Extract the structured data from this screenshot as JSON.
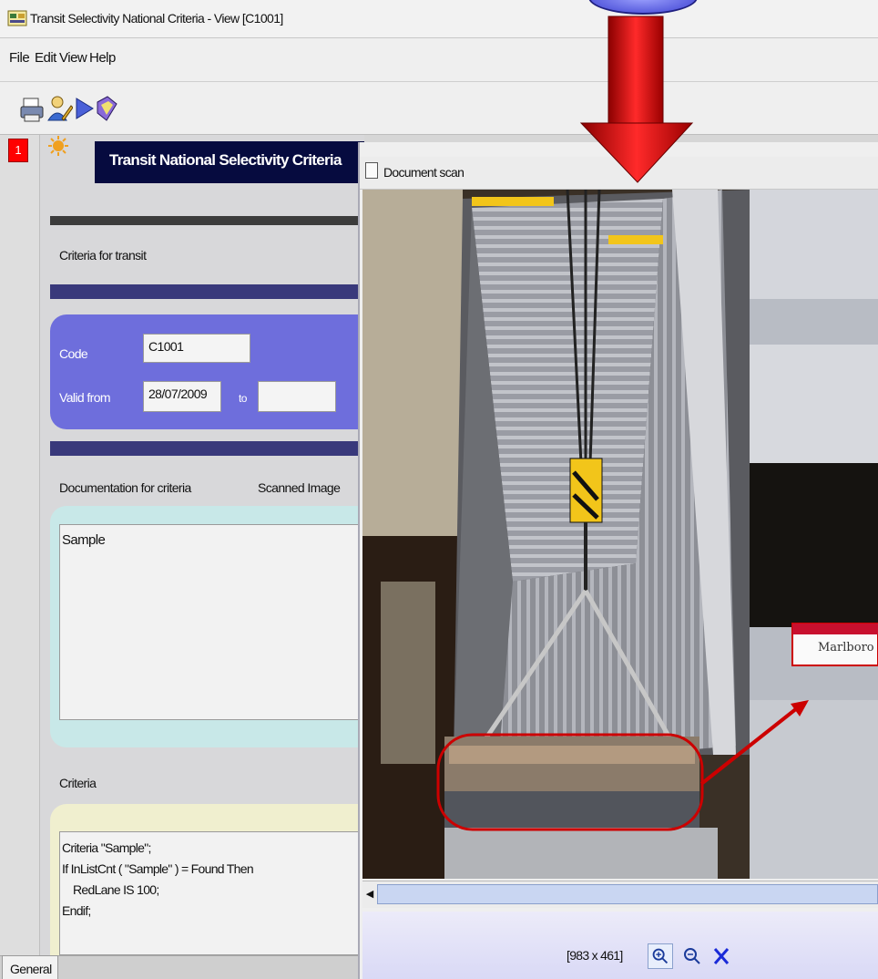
{
  "window": {
    "title": "Transit Selectivity National Criteria - View [C1001]"
  },
  "menu": [
    "File",
    "Edit",
    "View",
    "Help"
  ],
  "toolbar": {
    "icons": [
      "printer-icon",
      "user-edit-icon",
      "play-icon",
      "book-icon"
    ]
  },
  "record": {
    "badge": "1"
  },
  "form": {
    "header": "Transit National Selectivity Criteria",
    "section_title": "Criteria for transit",
    "code_label": "Code",
    "code_value": "C1001",
    "valid_from_label": "Valid from",
    "valid_from_value": "28/07/2009",
    "to_label": "to",
    "to_value": "",
    "documentation_label": "Documentation for criteria",
    "scanned_image_label": "Scanned Image",
    "documentation_value": "Sample",
    "criteria_label": "Criteria",
    "criteria_lines": [
      "Criteria \"Sample\";",
      "If InListCnt ( \"Sample\" ) = Found Then",
      "RedLane IS 100;",
      "Endif;"
    ]
  },
  "tabs": [
    "General"
  ],
  "scan_window": {
    "title": "Document scan",
    "photo_text": "Marlboro",
    "image_size": "[983 x 461]",
    "controls": [
      "zoom-in-icon",
      "zoom-out-icon",
      "close-icon"
    ]
  },
  "colors": {
    "header_bg": "#060b3f",
    "code_panel": "#6e6edc",
    "doc_panel": "#c8e8e8",
    "criteria_panel": "#f0efcf",
    "record_badge": "#ff0000",
    "arrow": "#e00000"
  }
}
